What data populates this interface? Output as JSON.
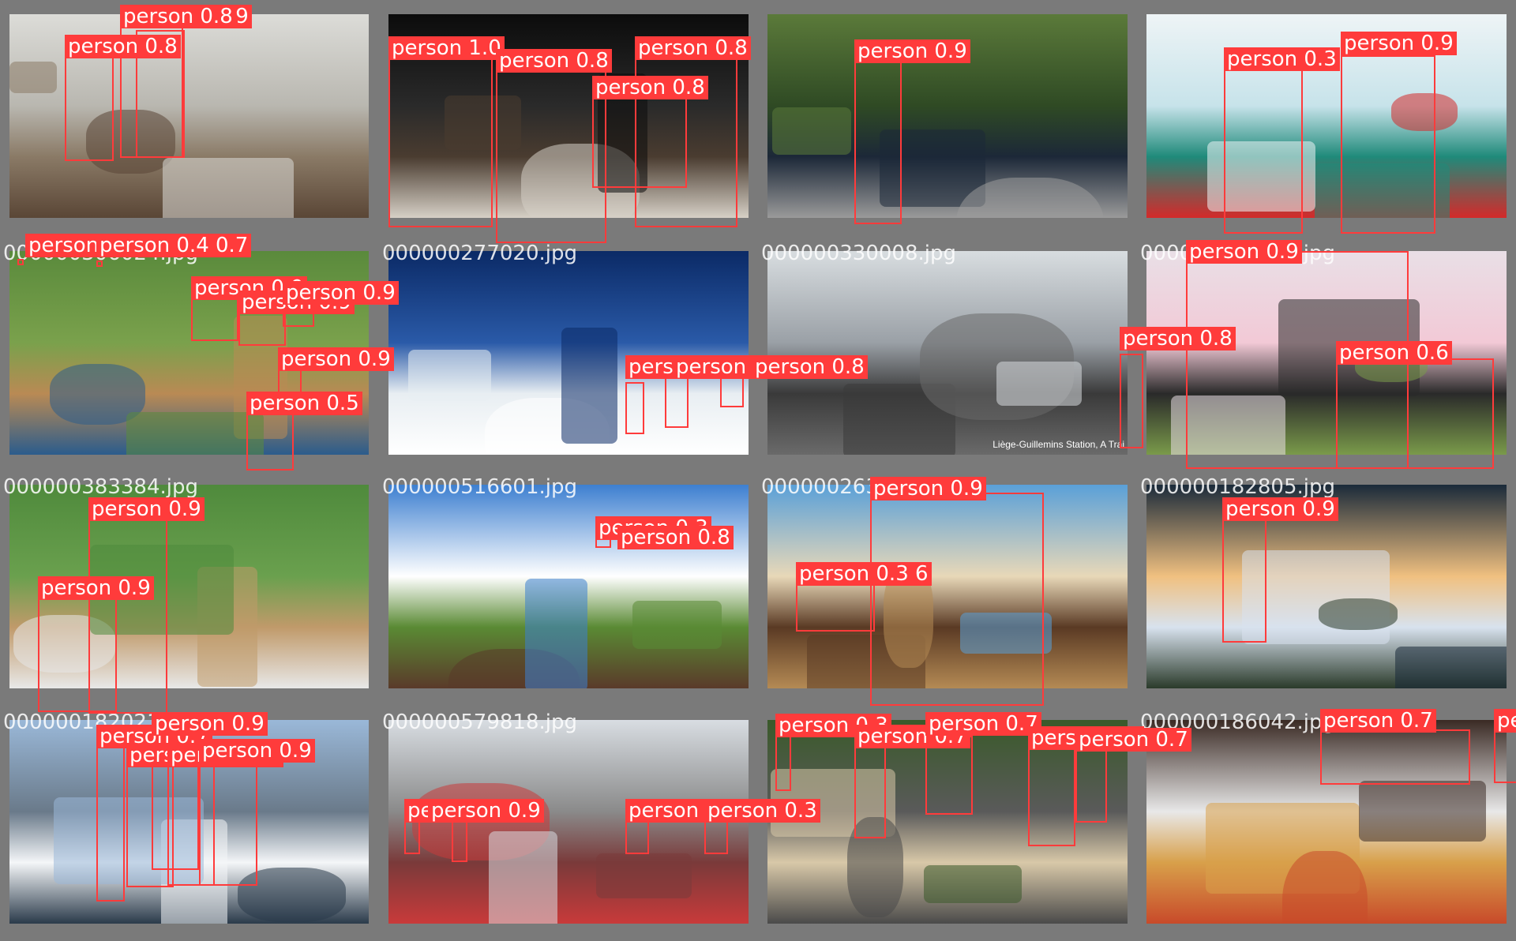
{
  "tiles": [
    {
      "name": "tile-street-dog",
      "filename": "",
      "scene": [
        "#dcdcd8",
        "#b9b7b0",
        "#8a7a66",
        "#5a4636"
      ],
      "boxes": [
        {
          "label": "person 0.9"
        },
        {
          "label": "person 0.8"
        },
        {
          "label": "person 0.8"
        }
      ]
    },
    {
      "name": "tile-dinner",
      "filename": "",
      "scene": [
        "#0c0c0c",
        "#2a2a2a",
        "#4a3c30",
        "#d6d0c6"
      ],
      "boxes": [
        {
          "label": "person 1.0"
        },
        {
          "label": "person 0.8"
        },
        {
          "label": "person 0.8"
        },
        {
          "label": "person 0.8"
        }
      ]
    },
    {
      "name": "tile-police-motorcycle",
      "filename": "",
      "scene": [
        "#5b7a3a",
        "#2f4a24",
        "#1c2838",
        "#9a9a9a"
      ],
      "boxes": [
        {
          "label": "person 0.9"
        }
      ]
    },
    {
      "name": "tile-child-snow",
      "filename": "",
      "scene": [
        "#eef4f6",
        "#c7e3ea",
        "#1f8a7a",
        "#d42a2a"
      ],
      "boxes": [
        {
          "label": "person 0.3"
        },
        {
          "label": "person 0.9"
        }
      ]
    },
    {
      "name": "tile-baseball-field",
      "filename": "000000306024.jpg",
      "scene": [
        "#5a8a3c",
        "#7aa14c",
        "#b98a54",
        "#2b5c8c"
      ],
      "boxes": [
        {
          "label": "person 0.3"
        },
        {
          "label": "person 0.4 0.7"
        },
        {
          "label": "person 0.9"
        },
        {
          "label": "person 0.9"
        },
        {
          "label": "person 0.9"
        },
        {
          "label": "person 0.9"
        },
        {
          "label": "person 0.5"
        }
      ]
    },
    {
      "name": "tile-ski-slope",
      "filename": "000000277020.jpg",
      "scene": [
        "#0b2a66",
        "#2a5aa8",
        "#e8eef2",
        "#ffffff"
      ],
      "boxes": [
        {
          "label": "person 0.3"
        },
        {
          "label": "person 0.5"
        },
        {
          "label": "person 0.8"
        }
      ]
    },
    {
      "name": "tile-train-station",
      "filename": "000000330008.jpg",
      "scene": [
        "#d8dde0",
        "#9aa0a6",
        "#3a3a3a",
        "#6a6a6a"
      ],
      "caption": "Liège-Guillemins Station, A Trai",
      "boxes": [
        {
          "label": "person 0.8"
        }
      ]
    },
    {
      "name": "tile-mother-child",
      "filename": "000000243148.jpg",
      "scene": [
        "#e9dfe6",
        "#f2c9d6",
        "#2a2a2a",
        "#7a9a4a"
      ],
      "boxes": [
        {
          "label": "person 0.9"
        },
        {
          "label": "person 0.6"
        }
      ]
    },
    {
      "name": "tile-baseball-batter",
      "filename": "000000383384.jpg",
      "scene": [
        "#4f8a3c",
        "#6aa04e",
        "#c09a6a",
        "#e8e8e8"
      ],
      "boxes": [
        {
          "label": "person 0.9"
        },
        {
          "label": "person 0.9"
        }
      ]
    },
    {
      "name": "tile-steam-train",
      "filename": "000000516601.jpg",
      "scene": [
        "#3d7fd0",
        "#ffffff",
        "#5a8a34",
        "#5a3a2a"
      ],
      "boxes": [
        {
          "label": "person 0.3"
        },
        {
          "label": "person 0.8"
        }
      ]
    },
    {
      "name": "tile-cowboy-horse",
      "filename": "000000263796.jpg",
      "scene": [
        "#5aa0d8",
        "#e8d8b8",
        "#5a3a24",
        "#b48a54"
      ],
      "boxes": [
        {
          "label": "person 0.9"
        },
        {
          "label": "person 0.3 6"
        }
      ]
    },
    {
      "name": "tile-snow-sunset",
      "filename": "000000182805.jpg",
      "scene": [
        "#1a2a3a",
        "#f0c080",
        "#d8e2ee",
        "#2a3a2a"
      ],
      "boxes": [
        {
          "label": "person 0.9"
        }
      ]
    },
    {
      "name": "tile-skiers-group",
      "filename": "000000182021.jpg",
      "scene": [
        "#9ab8d8",
        "#6a7a8a",
        "#f4f6f8",
        "#2a3a4a"
      ],
      "boxes": [
        {
          "label": "person 0.7"
        },
        {
          "label": "person 0.8"
        },
        {
          "label": "person 0.8"
        },
        {
          "label": "person 0.9"
        },
        {
          "label": "person 0.9"
        }
      ]
    },
    {
      "name": "tile-city-square",
      "filename": "000000579818.jpg",
      "scene": [
        "#d8dde2",
        "#8a8a8a",
        "#7a3a3a",
        "#c83a3a"
      ],
      "boxes": [
        {
          "label": "person 0.5"
        },
        {
          "label": "person 0.9"
        },
        {
          "label": "person 0.3"
        },
        {
          "label": "person 0.3"
        }
      ]
    },
    {
      "name": "tile-elephants",
      "filename": "",
      "scene": [
        "#3a5a2a",
        "#5a5a5a",
        "#d8c8a8",
        "#4a4a4a"
      ],
      "boxes": [
        {
          "label": "person 0.3"
        },
        {
          "label": "person 0.7"
        },
        {
          "label": "person 0.7"
        },
        {
          "label": "person 0.6"
        },
        {
          "label": "person 0.7"
        }
      ]
    },
    {
      "name": "tile-pizza",
      "filename": "000000186042.jpg",
      "scene": [
        "#3a2a24",
        "#e8e8e8",
        "#d8a04a",
        "#c84a2a"
      ],
      "boxes": [
        {
          "label": "person 0.7"
        },
        {
          "label": "pe"
        }
      ]
    }
  ]
}
